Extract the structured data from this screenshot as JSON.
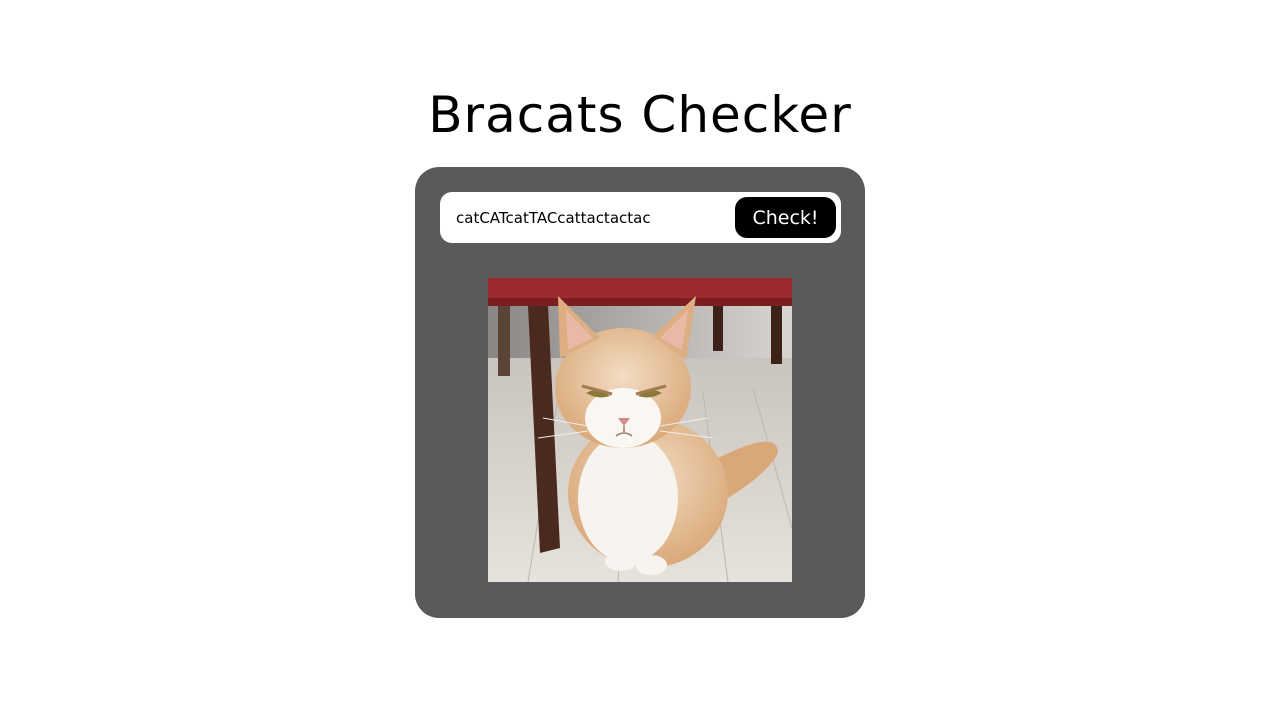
{
  "page": {
    "title": "Bracats Checker"
  },
  "checker": {
    "input_value": "catCATcatTACcattactactac",
    "button_label": "Check!"
  },
  "image": {
    "subject": "grumpy-cat-photo"
  },
  "colors": {
    "background": "#ffffff",
    "card": "#5a5a5a",
    "input_bg": "#ffffff",
    "button_bg": "#000000",
    "button_text": "#ffffff"
  }
}
